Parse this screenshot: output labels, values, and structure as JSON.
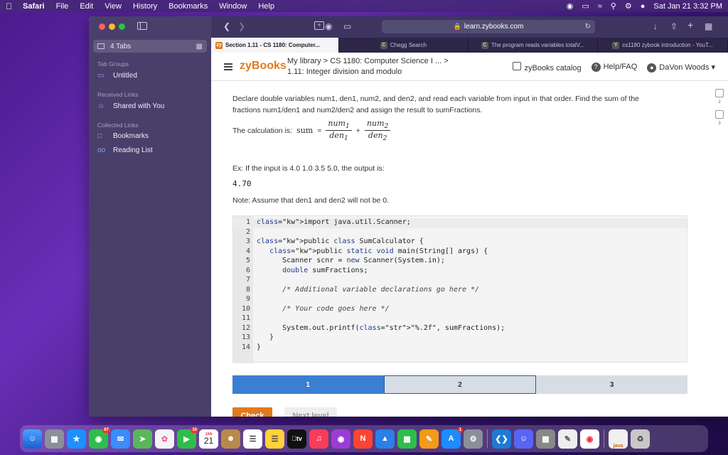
{
  "menubar": {
    "app": "Safari",
    "items": [
      "File",
      "Edit",
      "View",
      "History",
      "Bookmarks",
      "Window",
      "Help"
    ],
    "datetime": "Sat Jan 21  3:32 PM"
  },
  "sidebar": {
    "tabs_label": "4 Tabs",
    "tab_groups_heading": "Tab Groups",
    "untitled": "Untitled",
    "received_heading": "Received Links",
    "shared": "Shared with You",
    "collected_heading": "Collected Links",
    "bookmarks": "Bookmarks",
    "reading_list": "Reading List"
  },
  "toolbar": {
    "url": "learn.zybooks.com"
  },
  "tabs": [
    {
      "label": "Section 1.11 - CS 1180: Computer...",
      "fav": "zy",
      "fav_color": "#e07a1f"
    },
    {
      "label": "Chegg Search",
      "fav": "C",
      "fav_color": "#555"
    },
    {
      "label": "The program reads variables totalV...",
      "fav": "C",
      "fav_color": "#555"
    },
    {
      "label": "cs1180 zybook introduction - YouT...",
      "fav": "Y",
      "fav_color": "#555"
    }
  ],
  "header": {
    "logo": "zyBooks",
    "breadcrumb": "My library > CS 1180: Computer Science I ... >",
    "section": "1.11: Integer division and modulo",
    "catalog": "zyBooks catalog",
    "help": "Help/FAQ",
    "user": "DaVon Woods"
  },
  "problem": {
    "prompt": "Declare double variables num1, den1, num2, and den2, and read each variable from input in that order. Find the sum of the fractions num1/den1 and num2/den2 and assign the result to sumFractions.",
    "calc_label": "The calculation is:",
    "sum_var": "sum",
    "num1": "num",
    "num1_sub": "1",
    "den1": "den",
    "den1_sub": "1",
    "num2": "num",
    "num2_sub": "2",
    "den2": "den",
    "den2_sub": "2",
    "example": "Ex: If the input is 4.0 1.0 3.5 5.0, the output is:",
    "output": "4.70",
    "note": "Note: Assume that den1 and den2 will not be 0."
  },
  "code_lines": [
    "import java.util.Scanner;",
    "",
    "public class SumCalculator {",
    "   public static void main(String[] args) {",
    "      Scanner scnr = new Scanner(System.in);",
    "      double sumFractions;",
    "",
    "      /* Additional variable declarations go here */",
    "",
    "      /* Your code goes here */",
    "",
    "      System.out.printf(\"%.2f\", sumFractions);",
    "   }",
    "}"
  ],
  "progress": [
    "1",
    "2",
    "3"
  ],
  "buttons": {
    "check": "Check",
    "next": "Next level"
  },
  "side_checks": [
    "2",
    "3"
  ],
  "dock_badges": {
    "mail": "87",
    "calendar": "10",
    "app_store": "1"
  },
  "dock_labels": {
    "calendar_month": "JAN",
    "calendar_day": "21",
    "tv": "tv",
    "java": "java"
  }
}
